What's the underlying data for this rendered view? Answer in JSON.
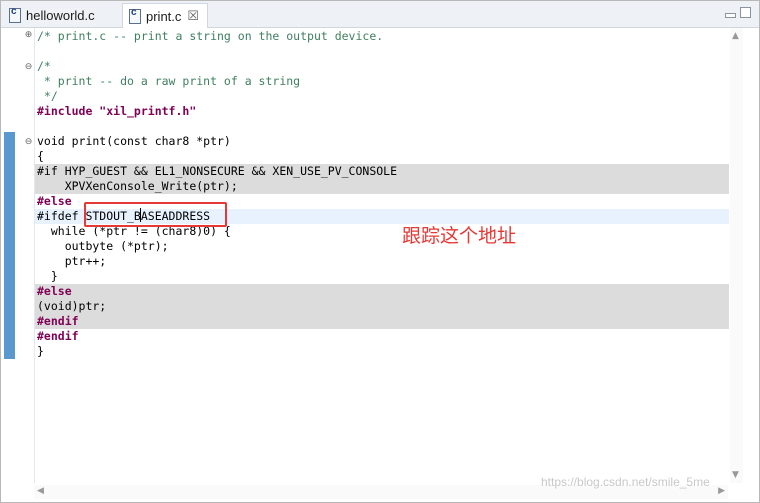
{
  "tabs": [
    {
      "label": "helloworld.c",
      "icon": "c-file-icon",
      "active": false
    },
    {
      "label": "print.c",
      "icon": "c-file-icon",
      "active": true,
      "close": "☒"
    }
  ],
  "window_controls": {
    "minimize": "minimize",
    "maximize": "maximize"
  },
  "code_lines": [
    {
      "text": "/* print.c -- print a string on the output device."
    },
    {
      "text": "/*"
    },
    {
      "text": " * print -- do a raw print of a string"
    },
    {
      "text": " */"
    },
    {
      "text": "#include \"xil_printf.h\""
    },
    {
      "text": "void print(const char8 *ptr)"
    },
    {
      "text": "{"
    },
    {
      "text": "#if HYP_GUEST && EL1_NONSECURE && XEN_USE_PV_CONSOLE"
    },
    {
      "text": "    XPVXenConsole_Write(ptr);"
    },
    {
      "text": "#else"
    },
    {
      "text": "#ifdef STDOUT_BASEADDRESS"
    },
    {
      "text": "  while (*ptr != (char8)0) {"
    },
    {
      "text": "    outbyte (*ptr);"
    },
    {
      "text": "    ptr++;"
    },
    {
      "text": "  }"
    },
    {
      "text": "#else"
    },
    {
      "text": "(void)ptr;"
    },
    {
      "text": "#endif"
    },
    {
      "text": "#endif"
    },
    {
      "text": "}"
    }
  ],
  "fold_markers": [
    "⊕",
    "⊖",
    "⊖"
  ],
  "annotation": "跟踪这个地址",
  "watermark": "https://blog.csdn.net/smile_5me",
  "colors": {
    "comment": "#3f7f5f",
    "keyword": "#7f0055",
    "string": "#2a00ff",
    "annotation": "#e53935",
    "inactive_code": "#dcdcdc",
    "current_line": "#e8f2fe"
  }
}
